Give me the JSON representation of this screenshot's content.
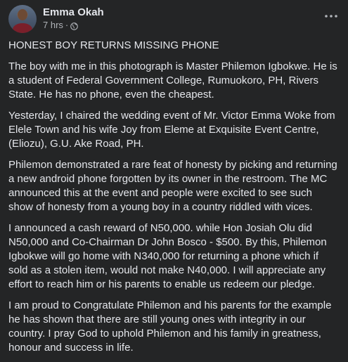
{
  "author": {
    "name": "Emma Okah",
    "time": "7 hrs",
    "separator": "·",
    "privacy_icon": "globe-icon"
  },
  "more_icon": "more-options-icon",
  "post": {
    "title": "HONEST BOY RETURNS MISSING PHONE",
    "paragraphs": [
      "The boy with me in this photograph is Master Philemon Igbokwe. He is a student of Federal Government College, Rumuokoro, PH, Rivers State. He has no phone, even the cheapest.",
      "Yesterday, I chaired the wedding event of Mr. Victor Emma Woke from Elele Town and his wife Joy from Eleme at Exquisite Event Centre, (Eliozu), G.U. Ake Road, PH.",
      "Philemon demonstrated a rare feat of honesty by picking and returning a new android phone forgotten by its owner in the restroom. The MC announced this at the event and people were excited to see such show of honesty from a young boy in a country riddled with vices.",
      "I announced a cash reward of N50,000. while Hon Josiah Olu did N50,000 and Co-Chairman Dr John Bosco - $500. By this, Philemon Igbokwe will go home with N340,000 for returning a phone which if sold as a stolen item, would not make N40,000. I will appreciate any effort to reach him or his parents to enable us redeem our pledge.",
      "I am proud to Congratulate Philemon and his parents for the example he has shown that there are still young ones with integrity in our country. I pray God to uphold Philemon and his family in greatness, honour and success in life."
    ]
  },
  "colors": {
    "background": "#242526",
    "text": "#e4e6eb",
    "secondary": "#b0b3b8"
  }
}
